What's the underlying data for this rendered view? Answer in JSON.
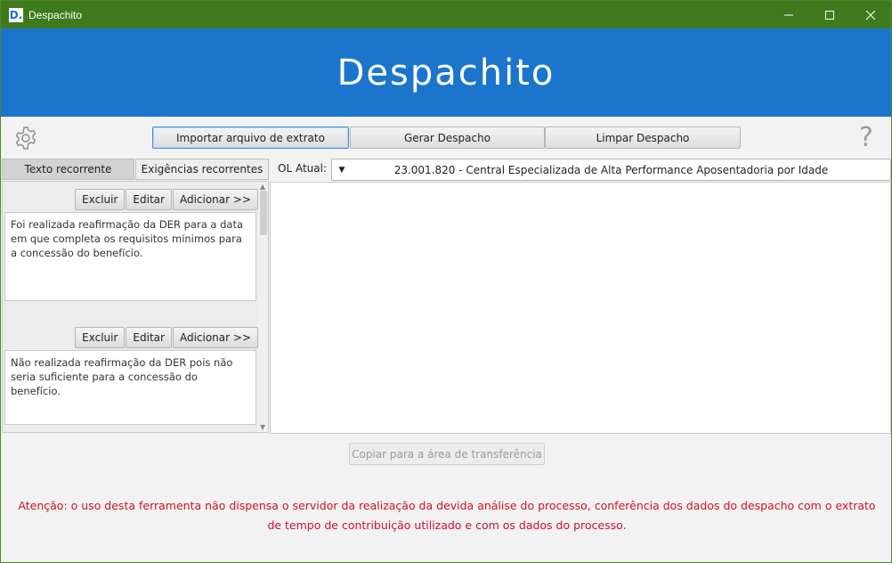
{
  "window": {
    "title": "Despachito",
    "icon_letter": "D.",
    "controls": {
      "minimize": "—",
      "maximize": "☐",
      "close": "✕"
    }
  },
  "banner": {
    "title": "Despachito"
  },
  "toolbar": {
    "settings_icon": "gear-icon",
    "import_label": "Importar arquivo de extrato",
    "generate_label": "Gerar Despacho",
    "clear_label": "Limpar Despacho",
    "help_icon": "question-icon",
    "help_glyph": "?"
  },
  "tabs": [
    {
      "label": "Texto recorrente",
      "active": true
    },
    {
      "label": "Exigências recorrentes",
      "active": false
    }
  ],
  "ol": {
    "label": "OL Atual:",
    "value": "23.001.820 - Central Especializada de Alta Performance Aposentadoria por Idade",
    "arrow": "▼"
  },
  "recurring_texts": [
    {
      "buttons": {
        "delete": "Excluir",
        "edit": "Editar",
        "add": "Adicionar >>"
      },
      "text": "Foi realizada reafirmação da DER para a data em que completa os requisitos mínimos para a concessão do benefício."
    },
    {
      "buttons": {
        "delete": "Excluir",
        "edit": "Editar",
        "add": "Adicionar >>"
      },
      "text": "Não realizada reafirmação da DER pois não seria suficiente para a concessão do benefício."
    }
  ],
  "output": {
    "text": ""
  },
  "copy_button": {
    "label": "Copiar para a área de transferência",
    "enabled": false
  },
  "warning": {
    "text": "Atenção: o uso desta ferramenta não dispensa o servidor da realização da devida análise do processo, conferência dos dados do despacho com o extrato de tempo de contribuição utilizado e com os dados do processo.",
    "color": "#d10f2a"
  },
  "colors": {
    "titlebar": "#3f7a1e",
    "banner": "#1b75cc"
  }
}
